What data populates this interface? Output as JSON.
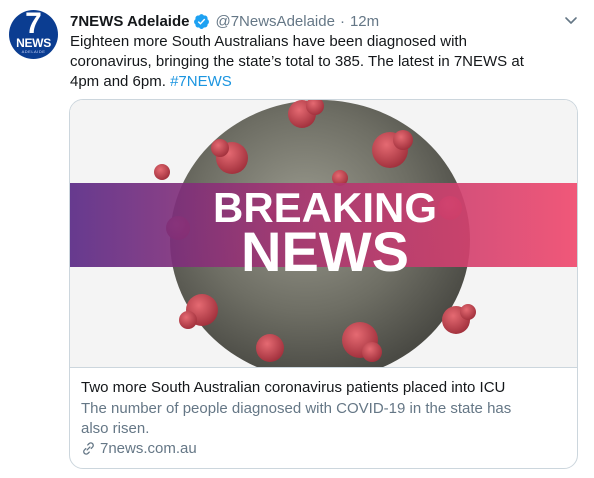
{
  "author": {
    "avatar_text": "7",
    "avatar_subtext": "NEWS",
    "avatar_small": "ADELAIDE",
    "name": "7NEWS Adelaide",
    "handle": "@7NewsAdelaide",
    "separator": "·",
    "time": "12m"
  },
  "tweet": {
    "lines": [
      "Eighteen more South Australians have been diagnosed with",
      "coronavirus, bringing the state’s total to 385. The latest in 7NEWS at",
      "4pm and 6pm. "
    ],
    "hashtag": "#7NEWS"
  },
  "card": {
    "image_line1": "BREAKING",
    "image_line2": "NEWS",
    "title": "Two more South Australian coronavirus patients placed into ICU",
    "desc_lines": [
      "The number of people diagnosed with COVID-19 in the state has",
      "also risen."
    ],
    "domain": "7news.com.au"
  },
  "colors": {
    "link": "#1b95e0",
    "secondary": "#657786",
    "banner_left": "#6b2a8c",
    "banner_right": "#ef4a6e"
  },
  "icons": [
    "verified-badge-icon",
    "chevron-down-icon",
    "link-icon"
  ]
}
